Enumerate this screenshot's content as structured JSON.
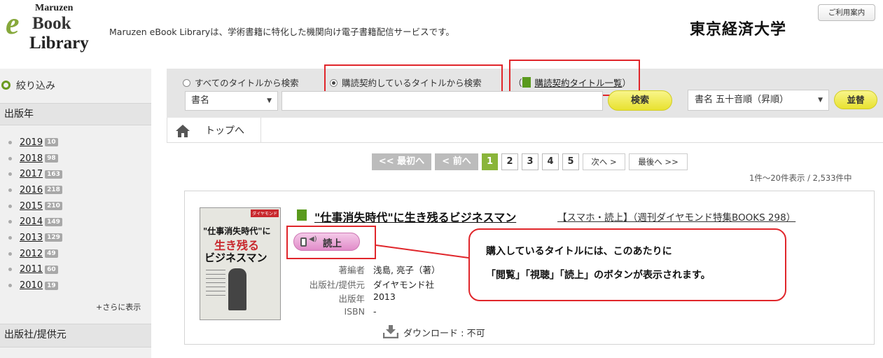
{
  "header": {
    "logo": {
      "line1": "Maruzen",
      "e_letter": "e",
      "line2": "Book",
      "line3": "Library"
    },
    "tagline": "Maruzen eBook Libraryは、学術書籍に特化した機関向け電子書籍配信サービスです。",
    "institution": "東京経済大学",
    "guide_button": "ご利用案内"
  },
  "sidebar": {
    "refine_label": "絞り込み",
    "year_heading": "出版年",
    "years": [
      {
        "year": "2019",
        "count": "10"
      },
      {
        "year": "2018",
        "count": "98"
      },
      {
        "year": "2017",
        "count": "163"
      },
      {
        "year": "2016",
        "count": "218"
      },
      {
        "year": "2015",
        "count": "210"
      },
      {
        "year": "2014",
        "count": "149"
      },
      {
        "year": "2013",
        "count": "129"
      },
      {
        "year": "2012",
        "count": "49"
      },
      {
        "year": "2011",
        "count": "60"
      },
      {
        "year": "2010",
        "count": "19"
      }
    ],
    "more_label": "+さらに表示",
    "publisher_heading": "出版社/提供元"
  },
  "search": {
    "option_all": "すべてのタイトルから検索",
    "option_subscribed": "購読契約しているタイトルから検索",
    "paren_open": "（",
    "subscribed_list_link": "購読契約タイトル一覧",
    "paren_close": "）",
    "field_select": "書名",
    "query_value": "",
    "search_button": "検索",
    "sort_select": "書名 五十音順（昇順）",
    "sort_button": "並替"
  },
  "breadcrumb": {
    "home": "トップへ"
  },
  "pagination": {
    "first": "<< 最初へ",
    "prev": "< 前へ",
    "pages": [
      "1",
      "2",
      "3",
      "4",
      "5"
    ],
    "current": "1",
    "next": "次へ >",
    "last": "最後へ >>",
    "result_count": "1件～20件表示 / 2,533件中"
  },
  "result": {
    "cover": {
      "brand": "ダイヤモンド",
      "line1": "\"仕事消失時代\"に",
      "line2": "生き残る",
      "line3": "ビジネスマン"
    },
    "title": "\"仕事消失時代\"に生き残るビジネスマン",
    "title_extra": "【スマホ・読上】（週刊ダイヤモンド特集BOOKS 298）",
    "read_button": "読上",
    "meta": [
      {
        "label": "著編者",
        "value": "浅島, 亮子（著）"
      },
      {
        "label": "出版社/提供元",
        "value": "ダイヤモンド社"
      },
      {
        "label": "出版年",
        "value": "2013"
      },
      {
        "label": "ISBN",
        "value": "-"
      }
    ],
    "download": "ダウンロード : 不可"
  },
  "callout": {
    "line1": "購入しているタイトルには、このあたりに",
    "line2": "「閲覧」「視聴」「読上」のボタンが表示されます。"
  },
  "colors": {
    "accent_green": "#8ab53a",
    "annotation_red": "#e0262b",
    "button_yellow": "#f0eb4a"
  }
}
